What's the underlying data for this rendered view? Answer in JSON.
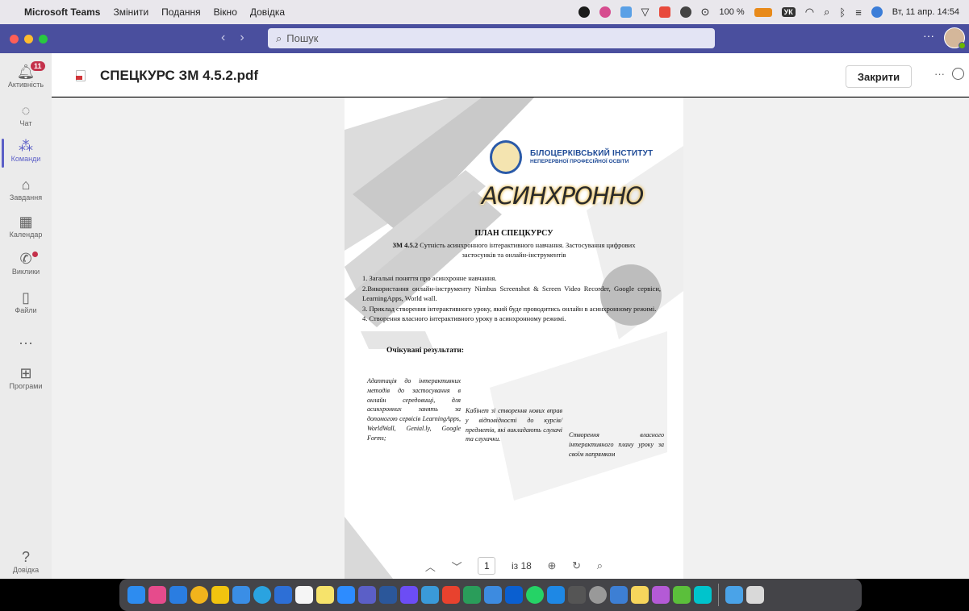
{
  "menubar": {
    "app_name": "Microsoft Teams",
    "menus": [
      "Змінити",
      "Подання",
      "Вікно",
      "Довідка"
    ],
    "battery": "100 %",
    "keyboard_layout": "УК",
    "datetime": "Вт, 11 апр.  14:54"
  },
  "titlebar": {
    "search_placeholder": "Пошук"
  },
  "rail": {
    "activity_badge": "11",
    "items": [
      {
        "label": "Активність",
        "icon": "bell-icon"
      },
      {
        "label": "Чат",
        "icon": "chat-icon"
      },
      {
        "label": "Команди",
        "icon": "teams-icon"
      },
      {
        "label": "Завдання",
        "icon": "assignments-icon"
      },
      {
        "label": "Календар",
        "icon": "calendar-icon"
      },
      {
        "label": "Виклики",
        "icon": "phone-icon"
      },
      {
        "label": "Файли",
        "icon": "file-icon"
      },
      {
        "label": "Програми",
        "icon": "apps-icon"
      },
      {
        "label": "Довідка",
        "icon": "help-icon"
      }
    ]
  },
  "viewer": {
    "file_name": "СПЕЦКУРС ЗМ 4.5.2.pdf",
    "close_label": "Закрити"
  },
  "document": {
    "institute_line1": "БІЛОЦЕРКІВСЬКИЙ ІНСТИТУТ",
    "institute_line2": "НЕПЕРЕРВНОЇ ПРОФЕСІЙНОЇ ОСВІТИ",
    "banner_word": "АСИНХРОННО",
    "plan_title": "ПЛАН СПЕЦКУРСУ",
    "plan_code": "ЗМ 4.5.2",
    "plan_subtitle": " Сутність асинхронного інтерактивного навчання. Застосування цифрових застосунків та онлайн-інструментів",
    "items": [
      "1. Загальні поняття про асинхронне навчання.",
      "2.Використання онлайн-інструменту Nimbus Screenshot & Screen Video Recorder, Google сервіси, LearningApps, World wall.",
      "3. Приклад створення інтерактивного уроку, який буде проводитись онлайн в асинхронному режимі.",
      "4. Створення власного інтерактивного уроку в асинхронному режимі."
    ],
    "results_heading": "Очікувані результати:",
    "result_col1": "Адаптація до інтерактивних методів до застосування в онлайн середовищі, для асинхронних занять за допомогою сервісів LearningApps, WorldWall, Genial.ly, Google Forms;",
    "result_col2": "Кабінет зі створення нових вправ у відповідності до курсів/предметів, які викладають слухачі та слухачки.",
    "result_col3": "Створення власного інтерактивного плану уроку за своїм напрямком"
  },
  "pdf_toolbar": {
    "current_page": "1",
    "page_count": "із 18"
  },
  "colors": {
    "teams_purple": "#4a4f9e",
    "accent": "#5b5fc7",
    "badge_red": "#c4314b"
  }
}
